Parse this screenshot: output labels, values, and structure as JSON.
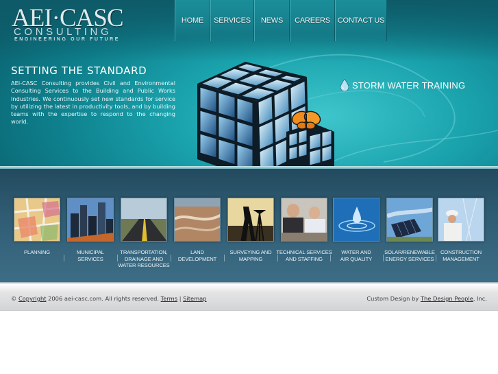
{
  "logo": {
    "name": "AEI·CASC",
    "consulting": "CONSULTING",
    "tagline": "ENGINEERING OUR FUTURE"
  },
  "nav": [
    "HOME",
    "SERVICES",
    "NEWS",
    "CAREERS",
    "CONTACT US"
  ],
  "intro": {
    "title": "SETTING THE STANDARD",
    "body": "AEI-CASC Consulting provides Civil and Environmental Consulting Services to the Building and Public Works Industries. We continuously set new standards for service by utilizing the latest in productivity tools, and by building teams with the expertise to respond to the changing world."
  },
  "promo": {
    "label": "STORM WATER TRAINING",
    "icon": "water-drop-icon"
  },
  "services": [
    {
      "lines": [
        "PLANNING"
      ]
    },
    {
      "lines": [
        "MUNICIPAL",
        "SERVICES"
      ]
    },
    {
      "lines": [
        "TRANSPORTATION,",
        "DRAINAGE AND",
        "WATER RESOURCES"
      ]
    },
    {
      "lines": [
        "LAND",
        "DEVELOPMENT"
      ]
    },
    {
      "lines": [
        "SURVEYING AND",
        "MAPPING"
      ]
    },
    {
      "lines": [
        "TECHNICAL SERVICES",
        "AND STAFFING"
      ]
    },
    {
      "lines": [
        "WATER AND",
        "AIR QUALITY"
      ]
    },
    {
      "lines": [
        "SOLAR/RENEWABLE",
        "ENERGY SERVICES"
      ]
    },
    {
      "lines": [
        "CONSTRUCTION",
        "MANAGEMENT"
      ]
    }
  ],
  "footer": {
    "copy_symbol": "©",
    "copyright_link": "Copyright",
    "copyright_rest": "2006 aei-casc.com. All rights reserved.",
    "terms_link": "Terms",
    "divider": "|",
    "sitemap_link": "Sitemap",
    "design_prefix": "Custom Design by",
    "design_link": "The Design People",
    "design_suffix": ", Inc."
  },
  "colors": {
    "hero_teal": "#1aa3ad",
    "services_band": "#2f5c73",
    "footer_gray": "#d3d4d6",
    "text_white": "#ffffff"
  }
}
